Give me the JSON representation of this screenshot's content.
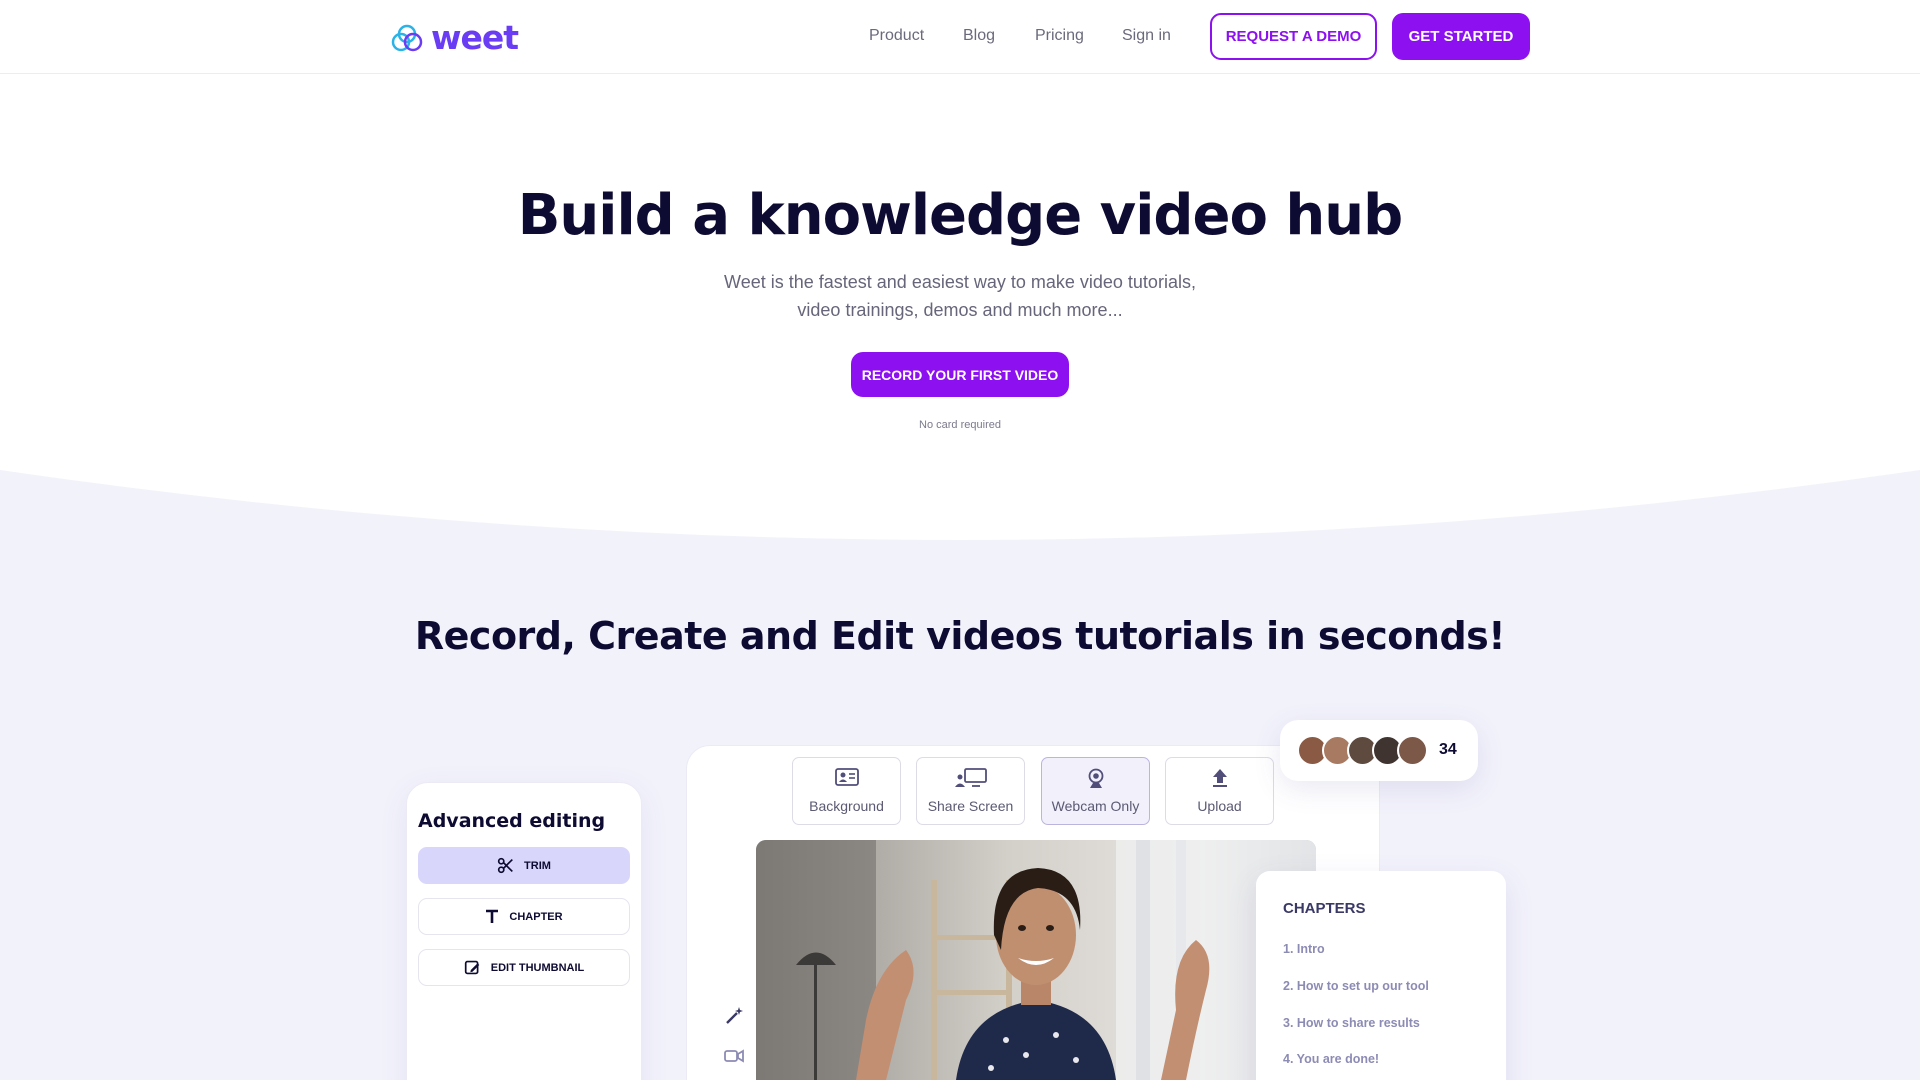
{
  "nav": {
    "logo_text": "weet",
    "links": [
      "Product",
      "Blog",
      "Pricing",
      "Sign in"
    ],
    "request_demo": "REQUEST A DEMO",
    "get_started": "GET STARTED"
  },
  "hero": {
    "title": "Build a knowledge video hub",
    "subtitle_line1": "Weet is the fastest and easiest way to make video tutorials,",
    "subtitle_line2": "video trainings, demos and much more...",
    "cta": "RECORD YOUR FIRST VIDEO",
    "note": "No card required"
  },
  "section": {
    "title": "Record, Create and Edit videos tutorials in seconds!"
  },
  "editing": {
    "title": "Advanced editing",
    "buttons": [
      {
        "label": "TRIM",
        "icon": "scissors-icon",
        "active": true
      },
      {
        "label": "CHAPTER",
        "icon": "text-icon",
        "active": false
      },
      {
        "label": "EDIT THUMBNAIL",
        "icon": "edit-thumbnail-icon",
        "active": false
      }
    ]
  },
  "recorder": {
    "modes": [
      {
        "label": "Background",
        "icon": "id-card-icon",
        "active": false
      },
      {
        "label": "Share Screen",
        "icon": "share-screen-icon",
        "active": false
      },
      {
        "label": "Webcam Only",
        "icon": "webcam-icon",
        "active": true
      },
      {
        "label": "Upload",
        "icon": "upload-icon",
        "active": false
      }
    ]
  },
  "viewers": {
    "count": "34"
  },
  "chapters": {
    "title": "CHAPTERS",
    "items": [
      "1. Intro",
      "2. How to set up our tool",
      "3. How to share results",
      "4. You are done!"
    ]
  },
  "colors": {
    "brand": "#8d10f0",
    "logo": "#6a3df5",
    "heading": "#0e0b33",
    "section_bg": "#f2f2fb"
  }
}
